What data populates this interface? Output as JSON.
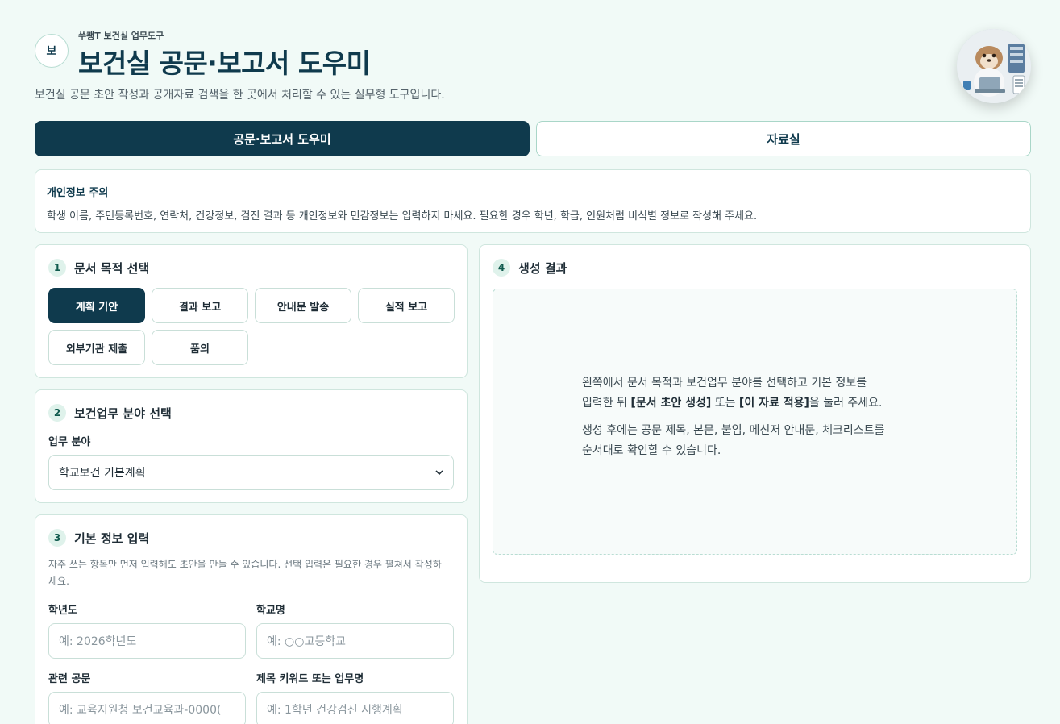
{
  "header": {
    "badge": "보",
    "subtitle": "쑤쾡T 보건실 업무도구",
    "title": "보건실 공문·보고서 도우미",
    "description": "보건실 공문 초안 작성과 공개자료 검색을 한 곳에서 처리할 수 있는 실무형 도구입니다."
  },
  "tabs": [
    {
      "label": "공문·보고서 도우미",
      "active": true
    },
    {
      "label": "자료실",
      "active": false
    }
  ],
  "privacy": {
    "title": "개인정보 주의",
    "text": "학생 이름, 주민등록번호, 연락처, 건강정보, 검진 결과 등 개인정보와 민감정보는 입력하지 마세요. 필요한 경우 학년, 학급, 인원처럼 비식별 정보로 작성해 주세요."
  },
  "step1": {
    "num": "1",
    "title": "문서 목적 선택",
    "options": [
      "계획 기안",
      "결과 보고",
      "안내문 발송",
      "실적 보고",
      "외부기관 제출",
      "품의"
    ],
    "selected": "계획 기안"
  },
  "step2": {
    "num": "2",
    "title": "보건업무 분야 선택",
    "field_label": "업무 분야",
    "selected": "학교보건 기본계획"
  },
  "step3": {
    "num": "3",
    "title": "기본 정보 입력",
    "helper": "자주 쓰는 항목만 먼저 입력해도 초안을 만들 수 있습니다. 선택 입력은 필요한 경우 펼쳐서 작성하세요.",
    "fields": [
      {
        "label": "학년도",
        "placeholder": "예: 2026학년도"
      },
      {
        "label": "학교명",
        "placeholder": "예: ○○고등학교"
      },
      {
        "label": "관련 공문",
        "placeholder": "예: 교육지원청 보건교육과-0000("
      },
      {
        "label": "제목 키워드 또는 업무명",
        "placeholder": "예: 1학년 건강검진 시행계획"
      }
    ]
  },
  "step4": {
    "num": "4",
    "title": "생성 결과",
    "line1": "왼쪽에서 문서 목적과 보건업무 분야를 선택하고 기본 정보를",
    "line2_a": "입력한 뒤 ",
    "line2_b": "[문서 초안 생성]",
    "line2_c": " 또는 ",
    "line2_d": "[이 자료 적용]",
    "line2_e": "을 눌러 주세요.",
    "line3": "생성 후에는 공문 제목, 본문, 붙임, 메신저 안내문, 체크리스트를",
    "line4": "순서대로 확인할 수 있습니다."
  }
}
